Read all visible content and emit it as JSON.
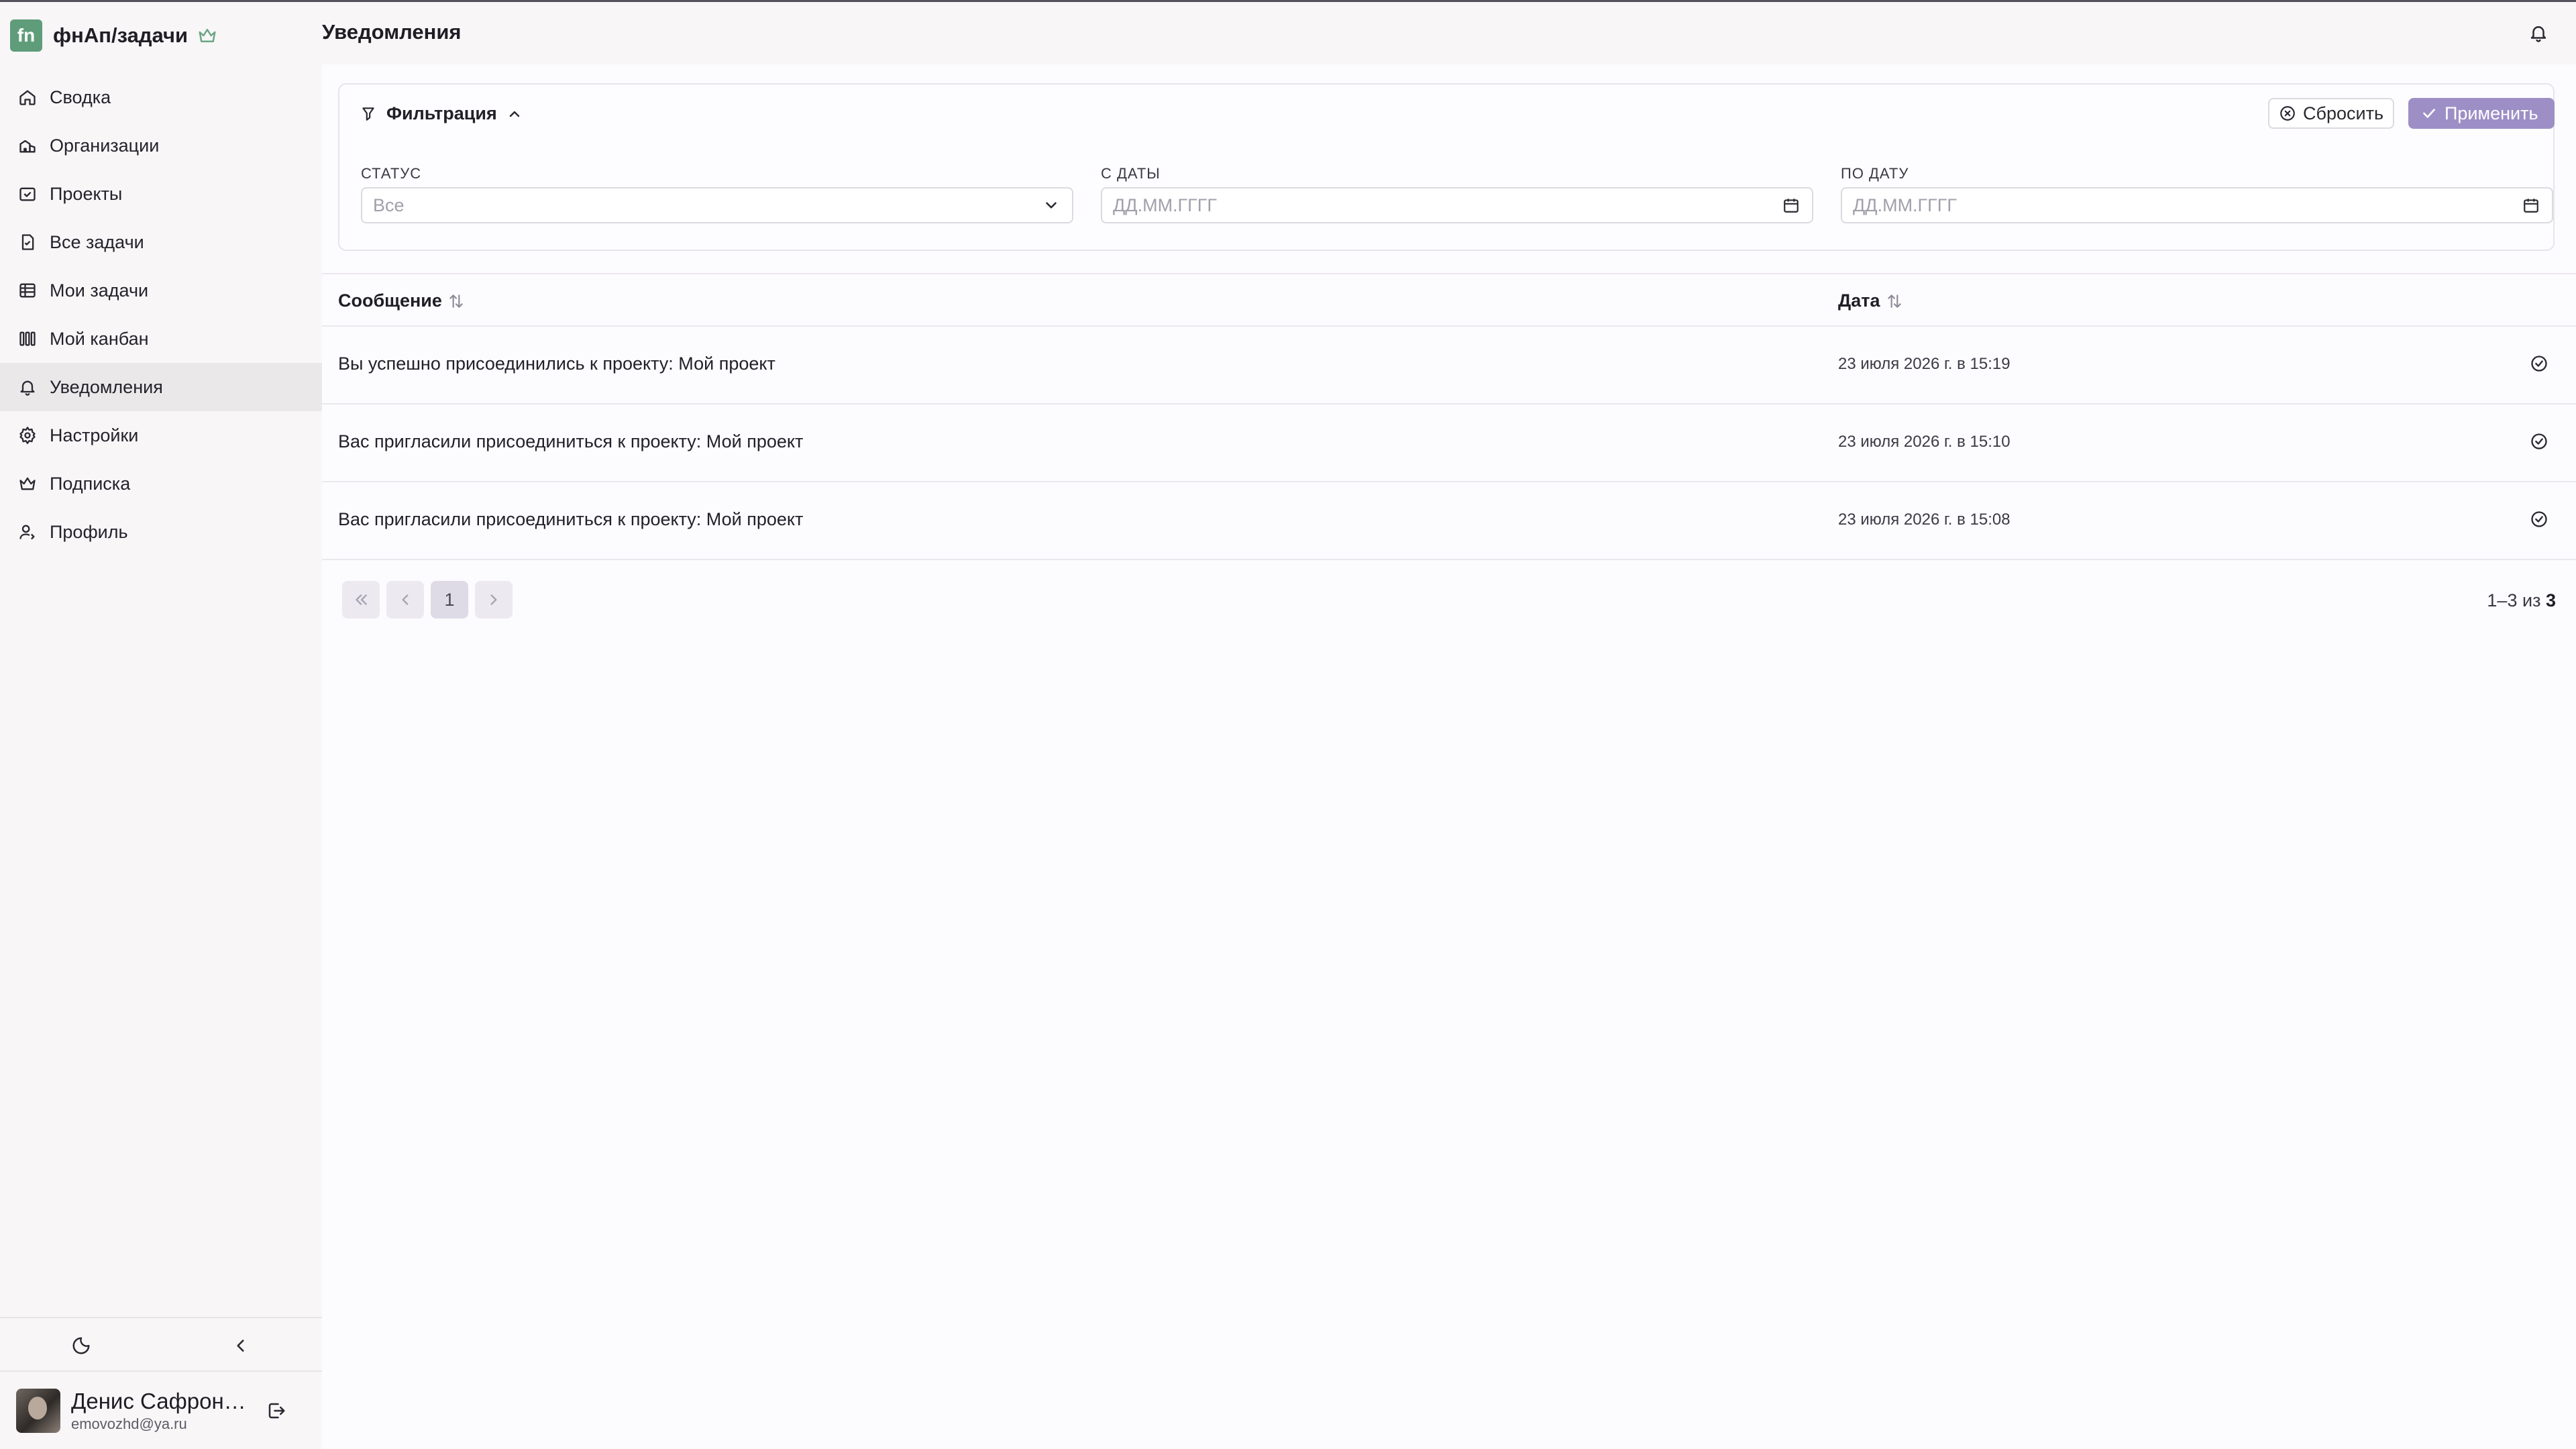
{
  "app": {
    "title": "фнАп/задачи",
    "logo_text": "fn"
  },
  "sidebar": {
    "items": [
      {
        "label": "Сводка",
        "icon": "home-icon"
      },
      {
        "label": "Организации",
        "icon": "organizations-icon"
      },
      {
        "label": "Проекты",
        "icon": "projects-icon"
      },
      {
        "label": "Все задачи",
        "icon": "all-tasks-icon"
      },
      {
        "label": "Мои задачи",
        "icon": "my-tasks-icon"
      },
      {
        "label": "Мой канбан",
        "icon": "kanban-icon"
      },
      {
        "label": "Уведомления",
        "icon": "bell-icon",
        "active": true
      },
      {
        "label": "Настройки",
        "icon": "settings-icon"
      },
      {
        "label": "Подписка",
        "icon": "crown-icon"
      },
      {
        "label": "Профиль",
        "icon": "profile-icon"
      }
    ]
  },
  "user": {
    "name": "Денис Сафроно...",
    "email": "emovozhd@ya.ru"
  },
  "header": {
    "title": "Уведомления"
  },
  "filter": {
    "title": "Фильтрация",
    "reset_label": "Сбросить",
    "apply_label": "Применить",
    "status": {
      "label": "СТАТУС",
      "value": "Все"
    },
    "date_from": {
      "label": "С ДАТЫ",
      "placeholder": "ДД.ММ.ГГГГ"
    },
    "date_to": {
      "label": "ПО ДАТУ",
      "placeholder": "ДД.ММ.ГГГГ"
    }
  },
  "table": {
    "columns": {
      "message": "Сообщение",
      "date": "Дата"
    },
    "rows": [
      {
        "message": "Вы успешно присоединились к проекту: Мой проект",
        "date": "23 июля 2026 г. в 15:19"
      },
      {
        "message": "Вас пригласили присоединиться к проекту: Мой проект",
        "date": "23 июля 2026 г. в 15:10"
      },
      {
        "message": "Вас пригласили присоединиться к проекту: Мой проект",
        "date": "23 июля 2026 г. в 15:08"
      }
    ]
  },
  "pagination": {
    "current_page": "1",
    "range": "1–3",
    "of": "из",
    "total": "3"
  },
  "colors": {
    "accent": "#9d8fc6",
    "brand": "#5f9d7a",
    "sidebar_bg": "#f8f6f7",
    "content_bg": "#fcfbfe"
  }
}
